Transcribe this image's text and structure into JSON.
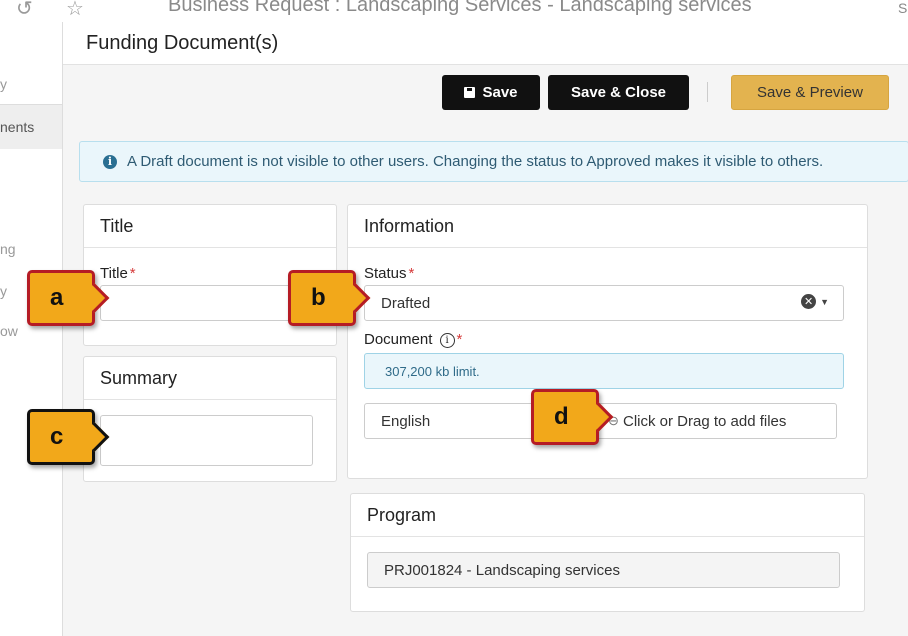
{
  "background": {
    "page_title": "Business Request : Landscaping Services - Landscaping services",
    "right_text": "S",
    "sidebar_items": [
      "y",
      "nents",
      "ng",
      "y",
      "ow"
    ]
  },
  "modal": {
    "title": "Funding Document(s)",
    "buttons": {
      "save": "Save",
      "save_close": "Save & Close",
      "save_preview": "Save & Preview"
    },
    "alert": "A Draft document is not visible to other users. Changing the status to Approved makes it visible to others.",
    "title_panel": {
      "heading": "Title",
      "field_label": "Title",
      "field_value": ""
    },
    "summary_panel": {
      "heading": "Summary",
      "field_value": ""
    },
    "information_panel": {
      "heading": "Information",
      "status_label": "Status",
      "status_value": "Drafted",
      "document_label": "Document",
      "document_hint": "307,200 kb limit.",
      "language_value": "English",
      "upload_text": "Click or Drag to add files"
    },
    "program_panel": {
      "heading": "Program",
      "program_value": "PRJ001824 - Landscaping services"
    },
    "required_marker": "*"
  },
  "callouts": {
    "a": "a",
    "b": "b",
    "c": "c",
    "d": "d"
  }
}
